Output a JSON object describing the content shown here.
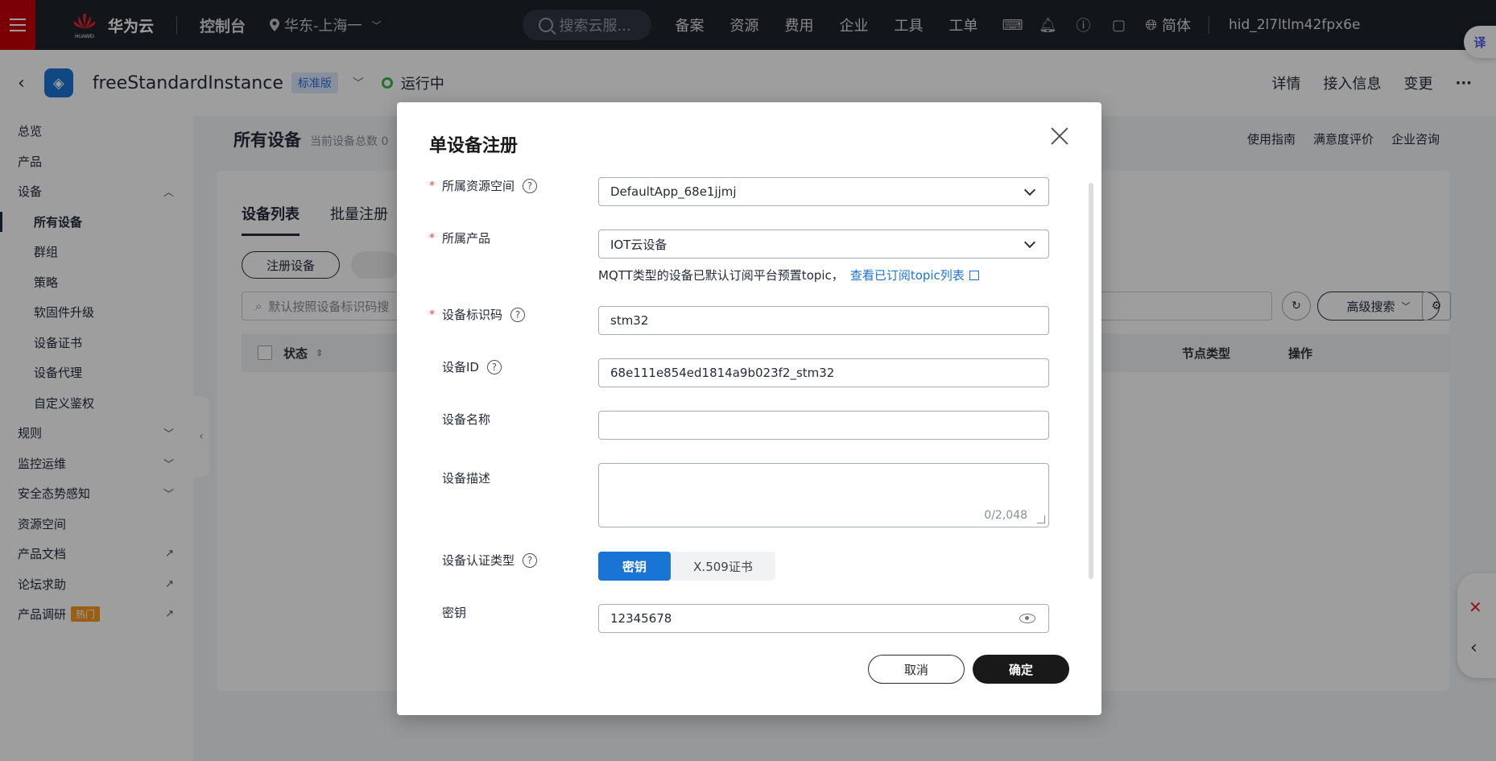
{
  "topbar": {
    "brand": "华为云",
    "brand_sub": "HUAWEI",
    "console": "控制台",
    "region": "华东-上海一",
    "search_placeholder": "搜索云服...",
    "nav": [
      "备案",
      "资源",
      "费用",
      "企业",
      "工具",
      "工单"
    ],
    "lang": "简体",
    "user": "hid_2l7ltlm42fpx6e"
  },
  "instance": {
    "name": "freeStandardInstance",
    "badge": "标准版",
    "status": "运行中",
    "actions": [
      "详情",
      "接入信息",
      "变更"
    ],
    "more": "···"
  },
  "sidebar": {
    "items": [
      {
        "label": "总览"
      },
      {
        "label": "产品"
      },
      {
        "label": "设备",
        "chev": "︿"
      },
      {
        "label": "所有设备"
      },
      {
        "label": "群组"
      },
      {
        "label": "策略"
      },
      {
        "label": "软固件升级"
      },
      {
        "label": "设备证书"
      },
      {
        "label": "设备代理"
      },
      {
        "label": "自定义鉴权"
      },
      {
        "label": "规则",
        "chev": "﹀"
      },
      {
        "label": "监控运维",
        "chev": "﹀"
      },
      {
        "label": "安全态势感知",
        "chev": "﹀"
      },
      {
        "label": "资源空间"
      },
      {
        "label": "产品文档",
        "chev": "↗"
      },
      {
        "label": "论坛求助",
        "chev": "↗"
      },
      {
        "label": "产品调研",
        "chev": "↗",
        "hot": "热门"
      }
    ]
  },
  "main": {
    "title": "所有设备",
    "subtitle": "当前设备总数 0",
    "help_links": [
      "使用指南",
      "满意度评价",
      "企业咨询"
    ],
    "tabs": [
      "设备列表",
      "批量注册"
    ],
    "register_button": "注册设备",
    "filter_placeholder": "默认按照设备标识码搜",
    "advanced_search": "高级搜索",
    "table_headers": {
      "status": "状态",
      "node_type": "节点类型",
      "op": "操作"
    }
  },
  "modal": {
    "title": "单设备注册",
    "fields": {
      "space_label": "所属资源空间",
      "space_value": "DefaultApp_68e1jjmj",
      "product_label": "所属产品",
      "product_value": "IOT云设备",
      "topic_hint": "MQTT类型的设备已默认订阅平台预置topic，",
      "topic_link": "查看已订阅topic列表",
      "node_id_label": "设备标识码",
      "node_id_value": "stm32",
      "device_id_label": "设备ID",
      "device_id_value": "68e111e854ed1814a9b023f2_stm32",
      "name_label": "设备名称",
      "name_value": "",
      "desc_label": "设备描述",
      "desc_counter": "0/2,048",
      "auth_label": "设备认证类型",
      "auth_options": [
        "密钥",
        "X.509证书"
      ],
      "secret_label": "密钥",
      "secret_value": "12345678"
    },
    "required_mark": "*",
    "help_glyph": "?",
    "cancel": "取消",
    "ok": "确定"
  },
  "floating": {
    "translate": "译"
  }
}
